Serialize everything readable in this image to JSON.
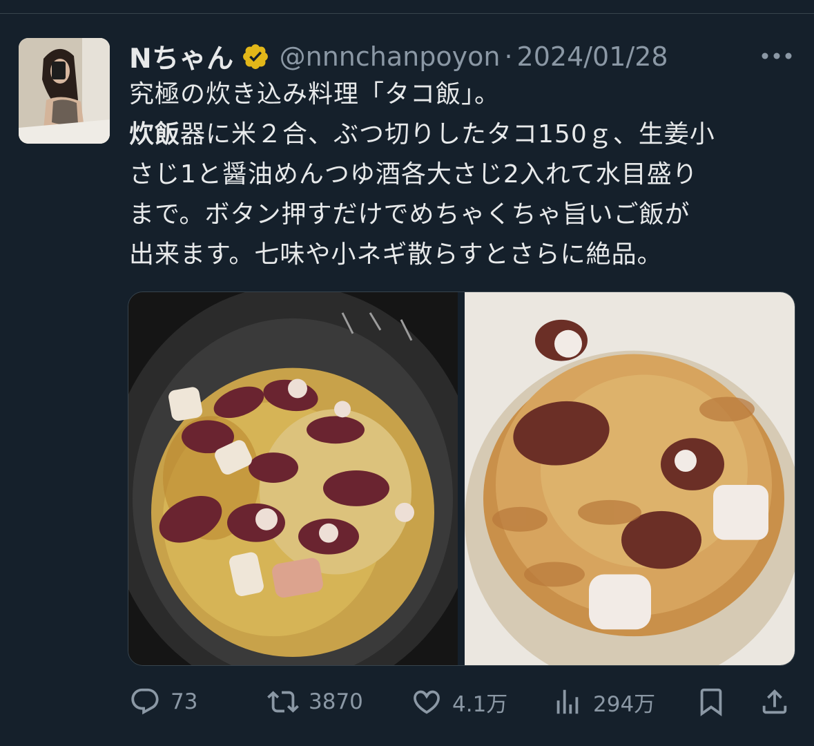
{
  "tweet": {
    "display_name": "Nちゃん",
    "handle": "@nnnchanpoyon",
    "separator": "·",
    "date": "2024/01/28",
    "text_lines": [
      "究極の炊き込み料理「タコ飯」。",
      "炊飯器に米２合、ぶつ切りしたタコ150ｇ、生姜小",
      "さじ1と醤油めんつゆ酒各大さじ2入れて水目盛り",
      "まで。ボタン押すだけでめちゃくちゃ旨いご飯が",
      "出来ます。七味や小ネギ散らすとさらに絶品。"
    ],
    "text_line2_bold": "炊飯",
    "text_line2_rest": "器に米２合、ぶつ切りしたタコ150ｇ、生姜小",
    "media": [
      {
        "icon": "photo-octopus-in-rice-cooker"
      },
      {
        "icon": "photo-octopus-rice-bowl"
      }
    ]
  },
  "actions": {
    "reply_count": "73",
    "retweet_count": "3870",
    "like_count": "4.1万",
    "views_count": "294万"
  },
  "icons": {
    "verified": "verified-gold-badge-icon",
    "more": "more-icon",
    "reply": "reply-icon",
    "retweet": "retweet-icon",
    "like": "heart-icon",
    "views": "views-icon",
    "bookmark": "bookmark-icon",
    "share": "share-icon"
  },
  "colors": {
    "background": "#15202b",
    "text": "#e7e9ea",
    "secondary": "#8b98a5",
    "verified": "#e2b719",
    "border": "#38444d"
  }
}
